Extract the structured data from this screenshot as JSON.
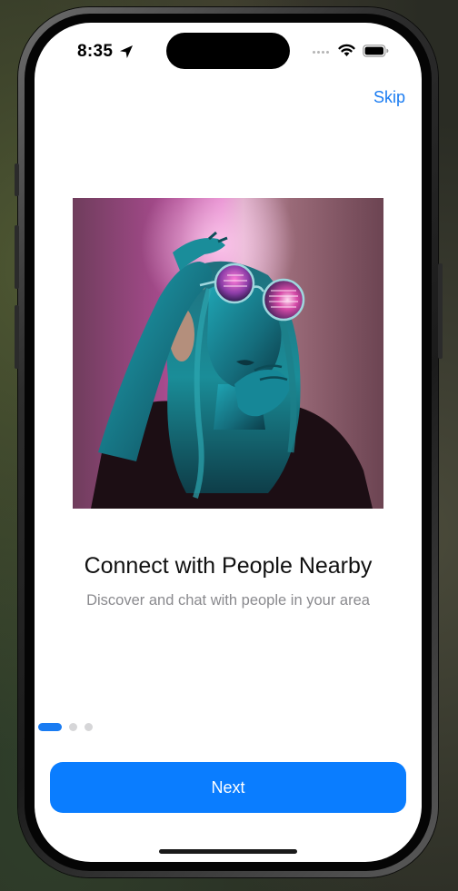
{
  "status_bar": {
    "time": "8:35"
  },
  "onboarding": {
    "skip_label": "Skip",
    "title": "Connect with People Nearby",
    "subtitle": "Discover and chat with people in your area",
    "page_indicator": {
      "total_pages": 3,
      "current_page": 1
    },
    "next_label": "Next"
  },
  "colors": {
    "accent": "#0a7dff",
    "link": "#1a7cf2",
    "subtitle_text": "#8a8a8e",
    "inactive_dot": "#d6d6d8"
  },
  "icons": {
    "location": "location-arrow-icon",
    "signal": "cellular-signal-icon",
    "wifi": "wifi-icon",
    "battery": "battery-icon"
  },
  "hero_image": {
    "subject": "woman in reflective round sunglasses under pink and teal neon light"
  }
}
